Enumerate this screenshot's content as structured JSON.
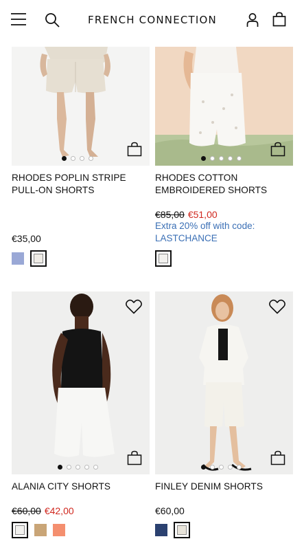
{
  "header": {
    "brand": "FRENCH CONNECTION",
    "menu_icon": "menu-icon",
    "search_icon": "search-icon",
    "account_icon": "account-icon",
    "bag_icon": "shopping-bag-icon"
  },
  "products": [
    {
      "name": "RHODES POPLIN STRIPE PULL-ON SHORTS",
      "price": "€35,00",
      "swatches": [
        {
          "color": "#9aa8d6",
          "selected": false
        },
        {
          "color": "#efece6",
          "selected": true
        }
      ],
      "image_dots": 4
    },
    {
      "name": "RHODES COTTON EMBROIDERED SHORTS",
      "old_price": "€85,00",
      "sale_price": "€51,00",
      "promo": "Extra 20% off with code: LASTCHANCE",
      "swatches": [
        {
          "color": "#f2f1ee",
          "selected": true
        }
      ],
      "image_dots": 5
    },
    {
      "name": "ALANIA CITY SHORTS",
      "old_price": "€60,00",
      "sale_price": "€42,00",
      "swatches": [
        {
          "color": "#f2f1ee",
          "selected": true
        },
        {
          "color": "#c9a577",
          "selected": false
        },
        {
          "color": "#f48f6f",
          "selected": false
        }
      ],
      "image_dots": 5
    },
    {
      "name": "FINLEY DENIM SHORTS",
      "price": "€60,00",
      "swatches": [
        {
          "color": "#2b4170",
          "selected": false
        },
        {
          "color": "#e8e4da",
          "selected": true
        }
      ],
      "image_dots": 5
    }
  ],
  "colors": {
    "sale": "#d0281f",
    "promo": "#3a6fb5",
    "text": "#111111"
  }
}
